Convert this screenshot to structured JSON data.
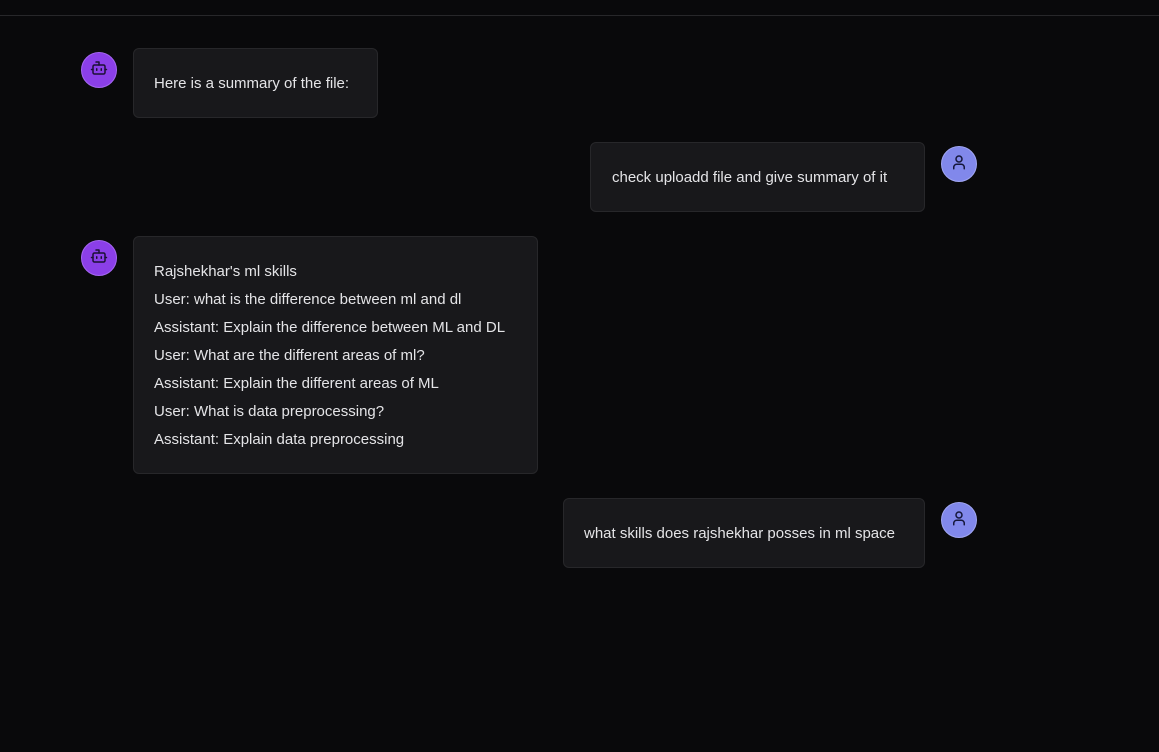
{
  "messages": [
    {
      "role": "assistant",
      "lines": [
        "Here is a summary of the file:"
      ]
    },
    {
      "role": "user",
      "lines": [
        "check uploadd file and give summary of it"
      ]
    },
    {
      "role": "assistant",
      "lines": [
        "Rajshekhar's ml skills",
        "User: what is the difference between ml and dl",
        "Assistant: Explain the difference between ML and DL",
        "User: What are the different areas of ml?",
        "Assistant: Explain the different areas of ML",
        "User: What is data preprocessing?",
        "Assistant: Explain data preprocessing"
      ]
    },
    {
      "role": "user",
      "lines": [
        "what skills does rajshekhar posses in ml space"
      ]
    }
  ],
  "icons": {
    "assistant": "bot-icon",
    "user": "user-icon"
  },
  "colors": {
    "background": "#09090b",
    "bubble": "#18181b",
    "bot_avatar": "#8b3fe8",
    "user_avatar": "#8188eb"
  }
}
